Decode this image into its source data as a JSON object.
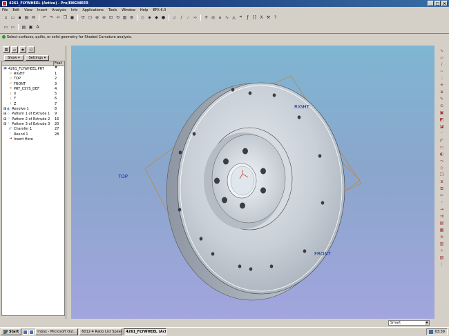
{
  "window": {
    "title": "4261_FLYWHEEL (Active) - Pro/ENGINEER"
  },
  "menu": [
    "File",
    "Edit",
    "View",
    "Insert",
    "Analysis",
    "Info",
    "Applications",
    "Tools",
    "Window",
    "Help",
    "EFX 6.0"
  ],
  "message": "Select surfaces, quilts, or solid geometry for Shaded Curvature analysis.",
  "panel": {
    "show_label": "Show ▾",
    "settings_label": "Settings ▾",
    "col_feat": "Feat #",
    "tree": [
      {
        "name": "4261_FLYWHEEL.PRT",
        "no": "",
        "icon": "part-icon",
        "indent": 0
      },
      {
        "name": "RIGHT",
        "no": "1",
        "icon": "datum-plane-icon",
        "indent": 1
      },
      {
        "name": "TOP",
        "no": "2",
        "icon": "datum-plane-icon",
        "indent": 1
      },
      {
        "name": "FRONT",
        "no": "3",
        "icon": "datum-plane-icon",
        "indent": 1
      },
      {
        "name": "PRT_CSYS_DEF",
        "no": "4",
        "icon": "csys-icon",
        "indent": 1
      },
      {
        "name": "X",
        "no": "5",
        "icon": "datum-axis-icon",
        "indent": 1
      },
      {
        "name": "Y",
        "no": "6",
        "icon": "datum-axis-icon",
        "indent": 1
      },
      {
        "name": "Z",
        "no": "7",
        "icon": "datum-axis-icon",
        "indent": 1
      },
      {
        "name": "Revolve 1",
        "no": "8",
        "icon": "revolve-icon",
        "indent": 0
      },
      {
        "name": "Pattern 1 of Extrude 1",
        "no": "9",
        "icon": "pattern-icon",
        "indent": 0
      },
      {
        "name": "Pattern 2 of Extrude 2",
        "no": "16",
        "icon": "pattern-icon",
        "indent": 0
      },
      {
        "name": "Pattern 3 of Extrude 3",
        "no": "20",
        "icon": "pattern-icon",
        "indent": 0
      },
      {
        "name": "Chamfer 1",
        "no": "27",
        "icon": "chamfer-icon",
        "indent": 1
      },
      {
        "name": "Round 1",
        "no": "28",
        "icon": "round-icon",
        "indent": 1
      },
      {
        "name": "Insert Here",
        "no": "",
        "icon": "insert-here-icon",
        "indent": 1
      }
    ]
  },
  "viewport": {
    "datum_labels": {
      "top": "TOP",
      "right": "RIGHT",
      "front": "FRONT"
    }
  },
  "status": {
    "filter": "Smart"
  },
  "taskbar": {
    "start": "Start",
    "tasks": [
      {
        "label": "Inbox - Microsoft Out...",
        "active": false
      },
      {
        "label": "6012-4 Ratio List  Speed ...",
        "active": false
      },
      {
        "label": "4261_FLYWHEEL (Activ...",
        "active": true
      }
    ],
    "clock": "03:39"
  },
  "colors": {
    "accent": "#0a246a",
    "datum_label": "#1030a0",
    "datum_line": "#b58a55"
  }
}
